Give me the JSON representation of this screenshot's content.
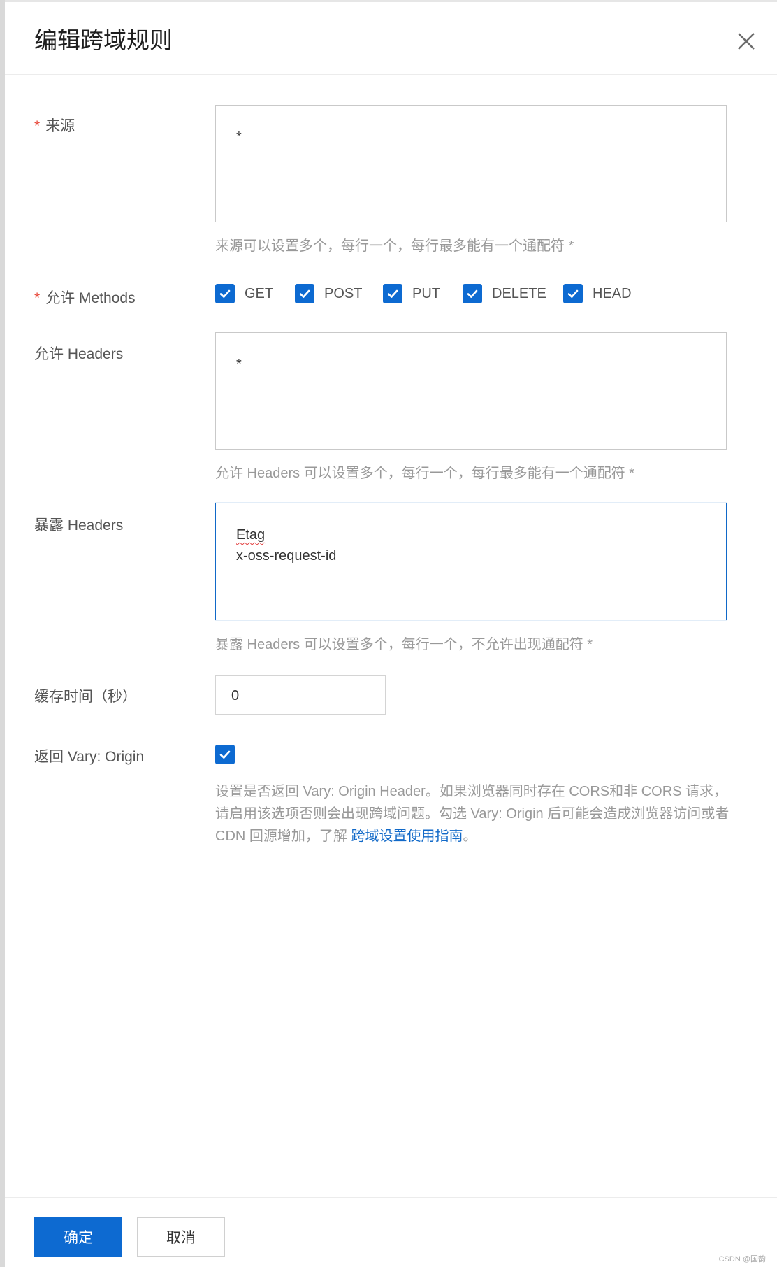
{
  "dialog": {
    "title": "编辑跨域规则"
  },
  "origin": {
    "label": "来源",
    "required_mark": "*",
    "value": "*",
    "help": "来源可以设置多个，每行一个，每行最多能有一个通配符 *"
  },
  "methods": {
    "label": "允许 Methods",
    "required_mark": "*",
    "options": [
      {
        "label": "GET",
        "checked": true
      },
      {
        "label": "POST",
        "checked": true
      },
      {
        "label": "PUT",
        "checked": true
      },
      {
        "label": "DELETE",
        "checked": true
      },
      {
        "label": "HEAD",
        "checked": true
      }
    ]
  },
  "allow_headers": {
    "label": "允许 Headers",
    "value": "*",
    "help": "允许 Headers 可以设置多个，每行一个，每行最多能有一个通配符 *"
  },
  "expose_headers": {
    "label": "暴露 Headers",
    "lines": [
      "Etag",
      "x-oss-request-id"
    ],
    "help": "暴露 Headers 可以设置多个，每行一个，不允许出现通配符 *"
  },
  "cache": {
    "label": "缓存时间（秒）",
    "value": "0"
  },
  "vary": {
    "label": "返回 Vary: Origin",
    "checked": true,
    "help": "设置是否返回 Vary: Origin Header。如果浏览器同时存在 CORS和非 CORS 请求，请启用该选项否则会出现跨域问题。勾选 Vary: Origin 后可能会造成浏览器访问或者 CDN 回源增加，了解 ",
    "link": "跨域设置使用指南",
    "help_end": "。"
  },
  "footer": {
    "confirm": "确定",
    "cancel": "取消"
  },
  "watermark": "CSDN @国韵",
  "icons": {
    "close": "close-icon",
    "check": "check-icon"
  },
  "colors": {
    "primary": "#0d6ad1",
    "required": "#e84a3c",
    "link": "#1169c8"
  }
}
